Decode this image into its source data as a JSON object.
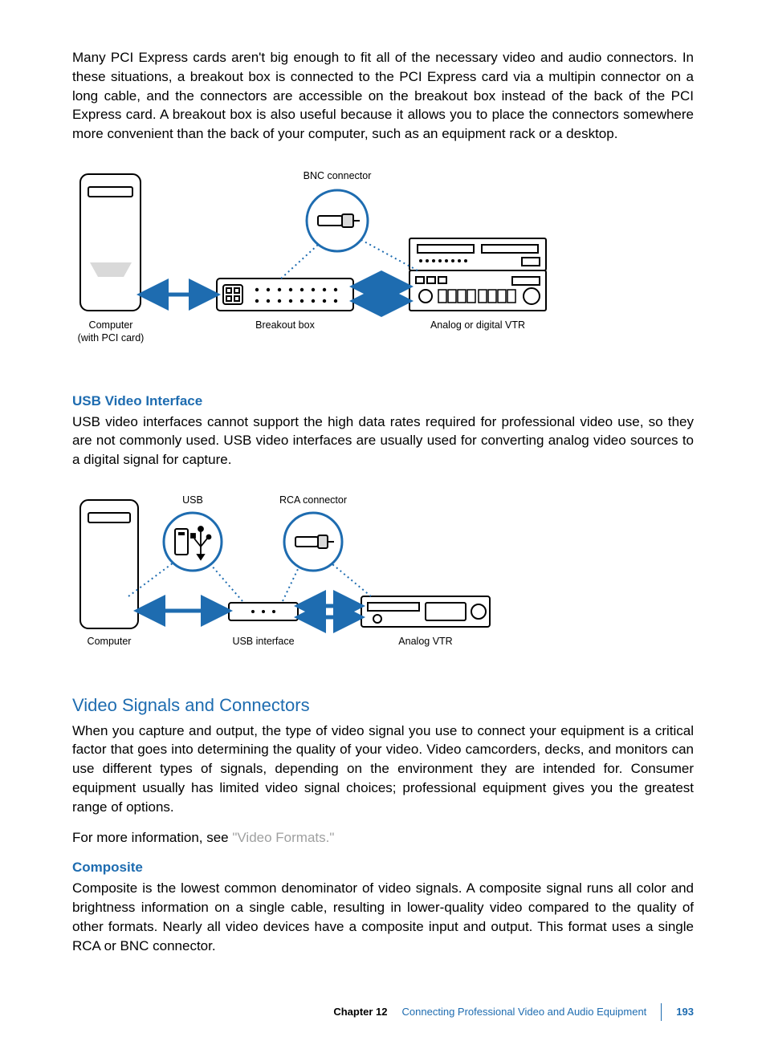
{
  "intro_paragraph": "Many PCI Express cards aren't big enough to fit all of the necessary video and audio connectors. In these situations, a breakout box is connected to the PCI Express card via a multipin connector on a long cable, and the connectors are accessible on the breakout box instead of the back of the PCI Express card. A breakout box is also useful because it allows you to place the connectors somewhere more convenient than the back of your computer, such as an equipment rack or a desktop.",
  "diagram1": {
    "bnc_label": "BNC connector",
    "computer_label_line1": "Computer",
    "computer_label_line2": "(with PCI card)",
    "breakout_label": "Breakout box",
    "vtr_label": "Analog or digital VTR"
  },
  "usb_heading": "USB Video Interface",
  "usb_paragraph": "USB video interfaces cannot support the high data rates required for professional video use, so they are not commonly used. USB video interfaces are usually used for converting analog video sources to a digital signal for capture.",
  "diagram2": {
    "usb_label": "USB",
    "rca_label": "RCA connector",
    "computer_label": "Computer",
    "interface_label": "USB interface",
    "vtr_label": "Analog VTR"
  },
  "signals_heading": "Video Signals and Connectors",
  "signals_paragraph": "When you capture and output, the type of video signal you use to connect your equipment is a critical factor that goes into determining the quality of your video. Video camcorders, decks, and monitors can use different types of signals, depending on the environment they are intended for. Consumer equipment usually has limited video signal choices; professional equipment gives you the greatest range of options.",
  "more_info_pre": "For more information, see ",
  "more_info_link": "\"Video Formats.\"",
  "composite_heading": "Composite",
  "composite_paragraph": "Composite is the lowest common denominator of video signals. A composite signal runs all color and brightness information on a single cable, resulting in lower-quality video compared to the quality of other formats. Nearly all video devices have a composite input and output. This format uses a single RCA or BNC connector.",
  "footer": {
    "chapter": "Chapter 12",
    "title": "Connecting Professional Video and Audio Equipment",
    "page": "193"
  }
}
